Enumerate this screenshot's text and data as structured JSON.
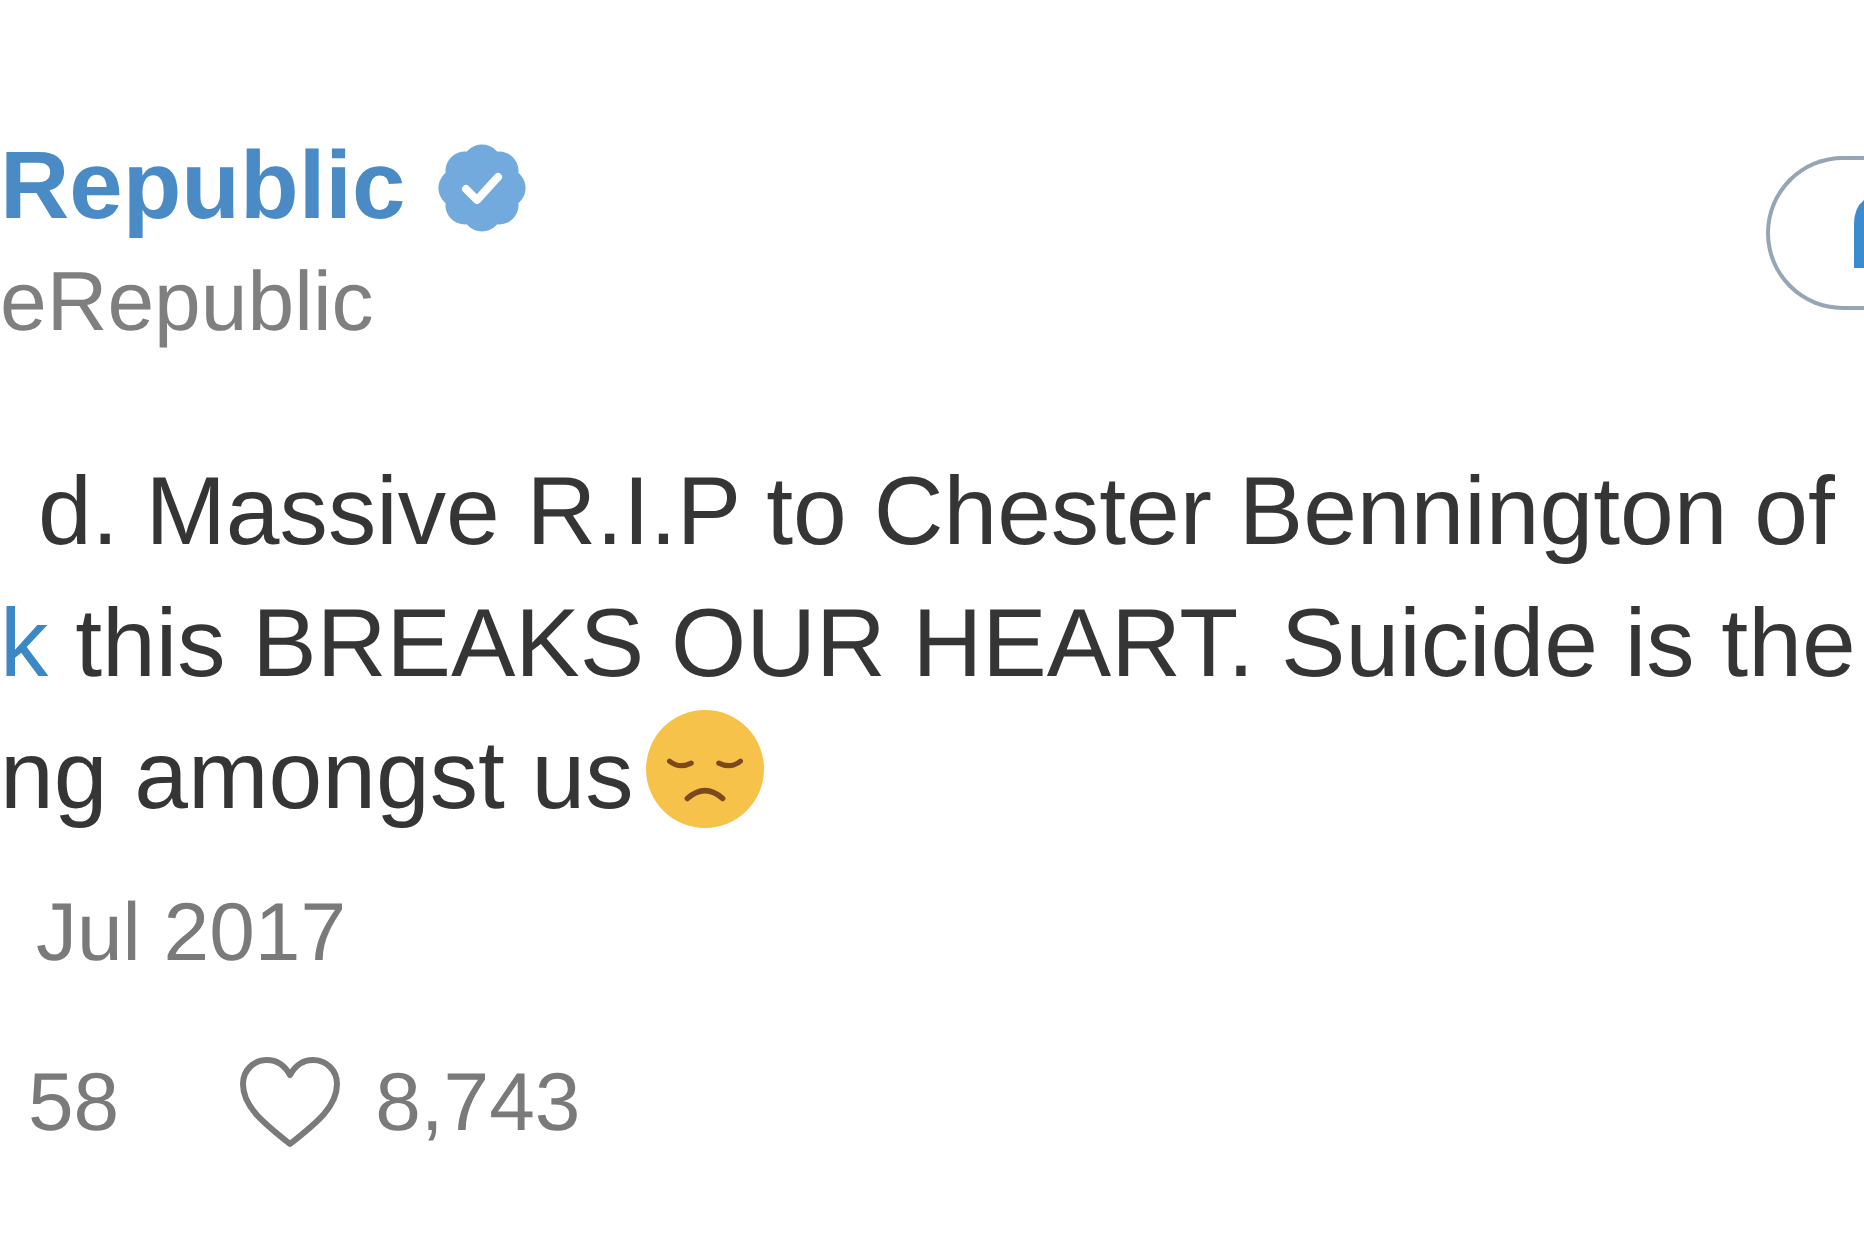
{
  "author": {
    "name": "Republic",
    "verified": true,
    "handle": "eRepublic"
  },
  "tweet": {
    "lines": [
      [
        {
          "kind": "text",
          "text": "d. Massive R.I.P to Chester Bennington of"
        }
      ],
      [
        {
          "kind": "link",
          "text": "k"
        },
        {
          "kind": "text",
          "text": " this BREAKS OUR HEART. Suicide is the"
        }
      ],
      [
        {
          "kind": "text",
          "text": "ng amongst us"
        },
        {
          "kind": "emoji"
        }
      ]
    ],
    "date": "Jul 2017"
  },
  "stats": [
    {
      "kind": "count",
      "text": "58"
    },
    {
      "kind": "like",
      "text": "8,743",
      "liked": false
    }
  ]
}
